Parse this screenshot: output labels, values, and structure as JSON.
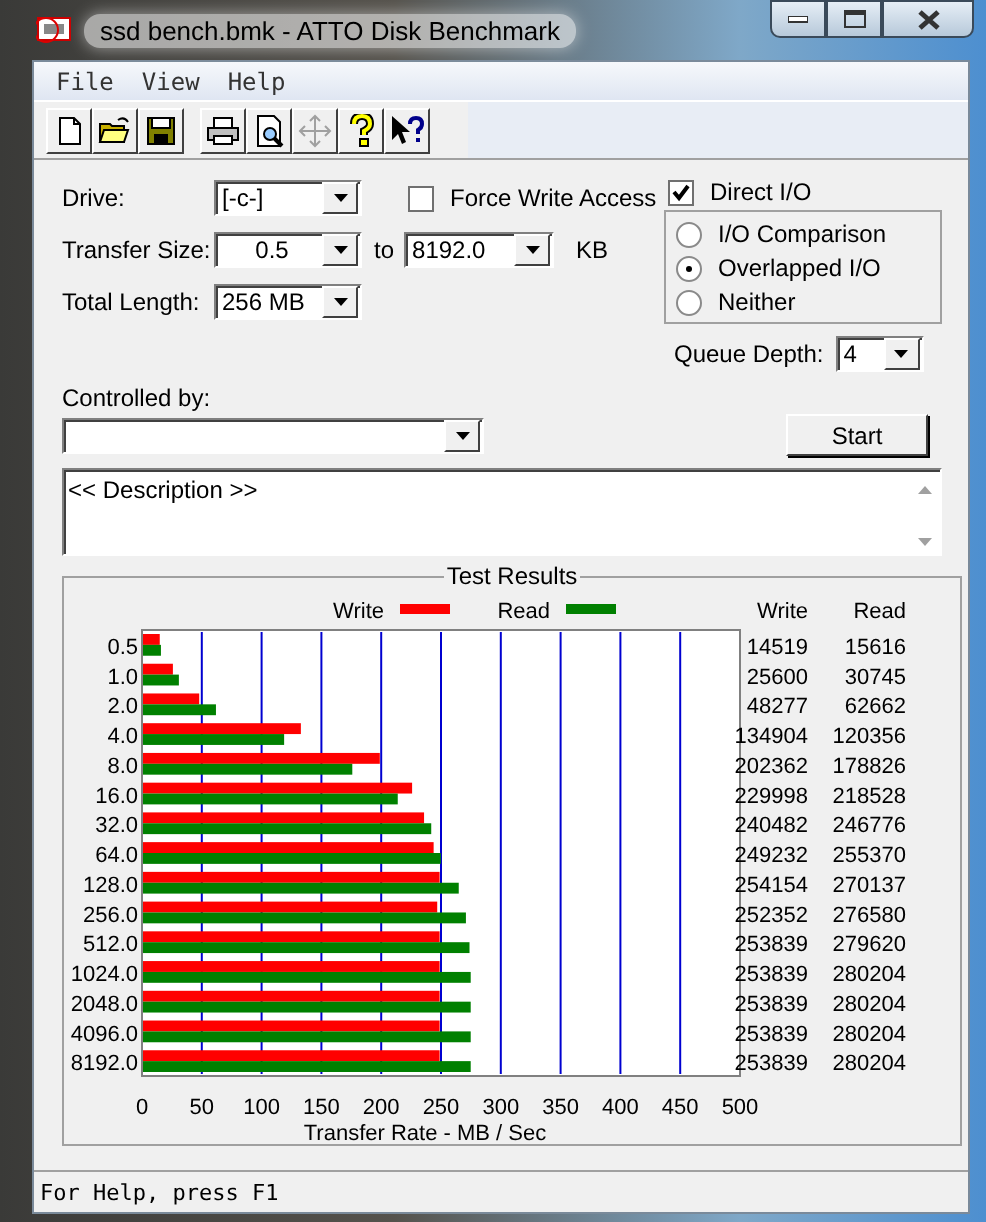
{
  "window": {
    "title": "ssd bench.bmk - ATTO Disk Benchmark"
  },
  "menu": [
    "File",
    "View",
    "Help"
  ],
  "toolbar": [
    {
      "kind": "new",
      "disabled": false
    },
    {
      "kind": "open",
      "disabled": false
    },
    {
      "kind": "save",
      "disabled": false
    },
    {
      "kind": "print",
      "disabled": false
    },
    {
      "kind": "preview",
      "disabled": false
    },
    {
      "kind": "move",
      "disabled": true
    },
    {
      "kind": "help",
      "disabled": false
    },
    {
      "kind": "context_help",
      "disabled": false
    }
  ],
  "settings": {
    "drive": {
      "label": "Drive:",
      "value": "[-c-]"
    },
    "transfer_size": {
      "label": "Transfer Size:",
      "from": "0.5",
      "to_label": "to",
      "to": "8192.0",
      "unit": "KB"
    },
    "total_length": {
      "label": "Total Length:",
      "value": "256 MB"
    },
    "force_write_access": {
      "label": "Force Write Access",
      "checked": false
    },
    "direct_io": {
      "label": "Direct I/O",
      "checked": true
    },
    "io_modes": [
      {
        "label": "I/O Comparison",
        "selected": false
      },
      {
        "label": "Overlapped I/O",
        "selected": true
      },
      {
        "label": "Neither",
        "selected": false
      }
    ],
    "queue_depth": {
      "label": "Queue Depth:",
      "value": "4"
    },
    "controlled_by": {
      "label": "Controlled by:"
    },
    "start_button": "Start",
    "description": "<< Description >>"
  },
  "results": {
    "title": "Test Results",
    "chart_data": {
      "type": "bar",
      "orientation": "horizontal",
      "grid": true,
      "legend": true,
      "xlabel": "Transfer Rate - MB / Sec",
      "xlim": [
        0,
        500
      ],
      "xticks": [
        0,
        50,
        100,
        150,
        200,
        250,
        300,
        350,
        400,
        450,
        500
      ],
      "categories": [
        "0.5",
        "1.0",
        "2.0",
        "4.0",
        "8.0",
        "16.0",
        "32.0",
        "64.0",
        "128.0",
        "256.0",
        "512.0",
        "1024.0",
        "2048.0",
        "4096.0",
        "8192.0"
      ],
      "series": [
        {
          "name": "Write",
          "color": "#ff0000",
          "values": [
            14,
            25,
            47,
            132,
            198,
            225,
            235,
            243,
            248,
            246,
            248,
            248,
            248,
            248,
            248
          ]
        },
        {
          "name": "Read",
          "color": "#008000",
          "values": [
            15,
            30,
            61,
            118,
            175,
            213,
            241,
            249,
            264,
            270,
            273,
            274,
            274,
            274,
            274
          ]
        }
      ]
    },
    "columns": [
      "Write",
      "Read"
    ],
    "rows": [
      {
        "write": "14519",
        "read": "15616"
      },
      {
        "write": "25600",
        "read": "30745"
      },
      {
        "write": "48277",
        "read": "62662"
      },
      {
        "write": "134904",
        "read": "120356"
      },
      {
        "write": "202362",
        "read": "178826"
      },
      {
        "write": "229998",
        "read": "218528"
      },
      {
        "write": "240482",
        "read": "246776"
      },
      {
        "write": "249232",
        "read": "255370"
      },
      {
        "write": "254154",
        "read": "270137"
      },
      {
        "write": "252352",
        "read": "276580"
      },
      {
        "write": "253839",
        "read": "279620"
      },
      {
        "write": "253839",
        "read": "280204"
      },
      {
        "write": "253839",
        "read": "280204"
      },
      {
        "write": "253839",
        "read": "280204"
      },
      {
        "write": "253839",
        "read": "280204"
      }
    ]
  },
  "status_bar": "For Help, press F1"
}
